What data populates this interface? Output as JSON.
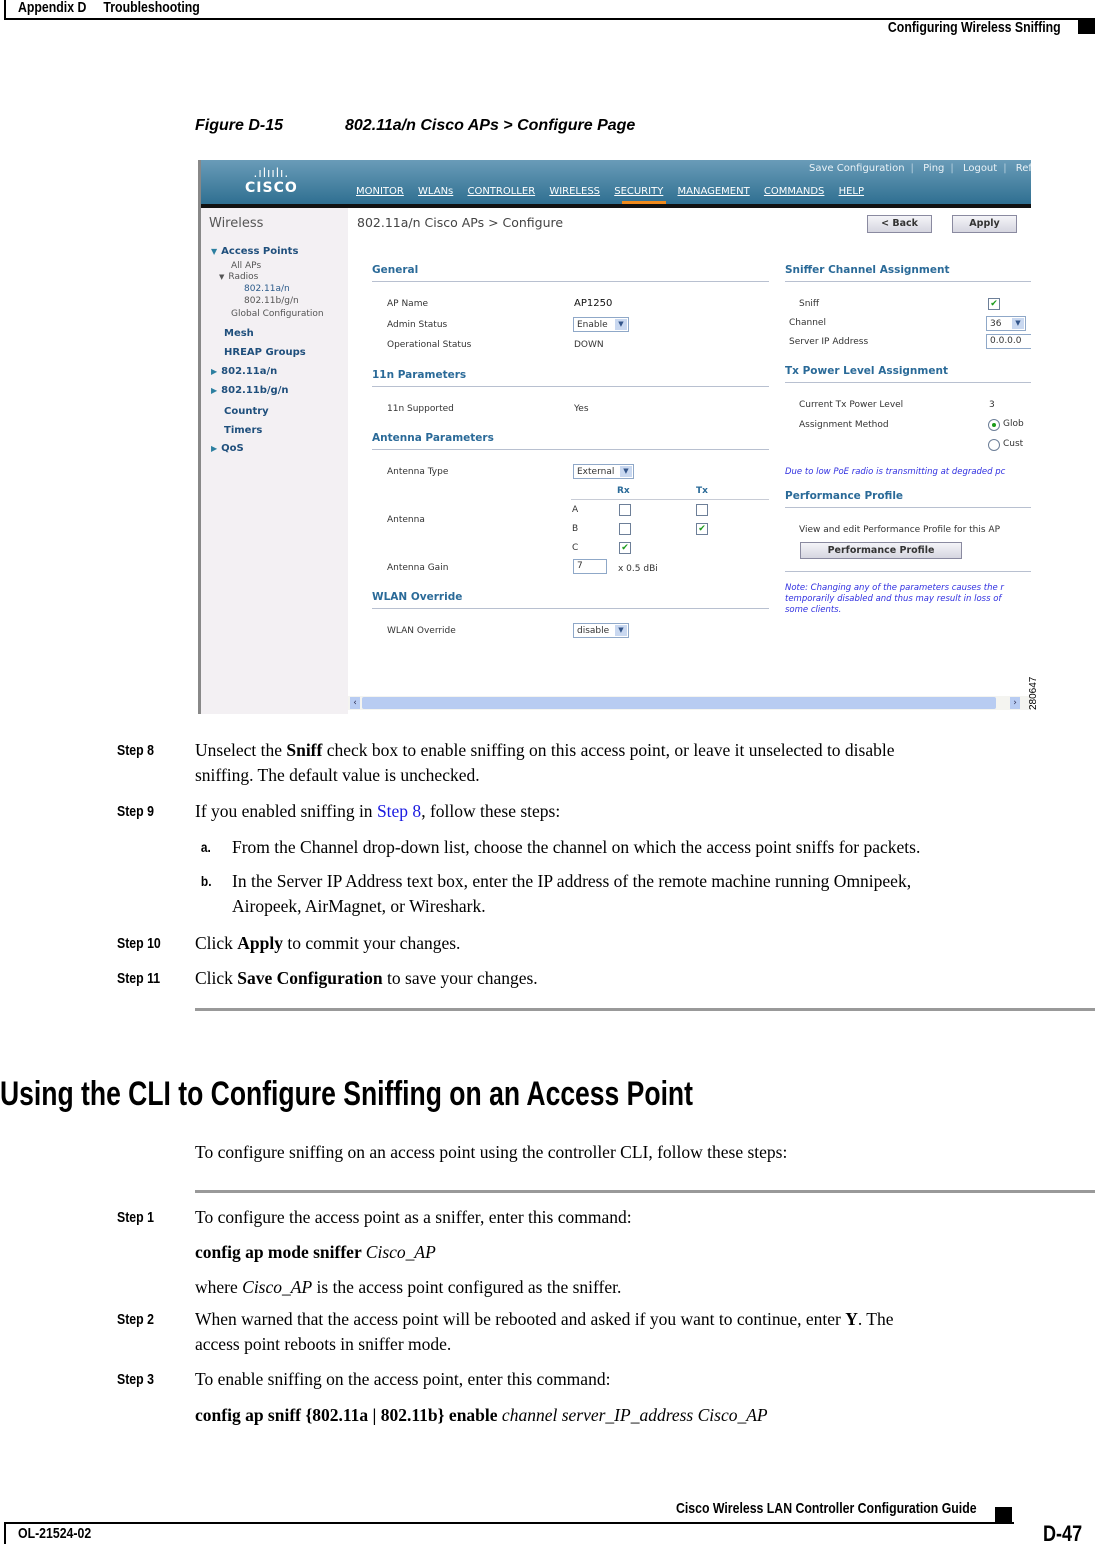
{
  "page_header": {
    "appendix": "Appendix D",
    "chapter": "Troubleshooting",
    "section": "Configuring Wireless Sniffing"
  },
  "figure": {
    "number": "Figure D-15",
    "title": "802.11a/n Cisco APs > Configure Page",
    "id": "280647"
  },
  "screenshot": {
    "logo": {
      "bars": ".ılıılı.",
      "word": "CISCO"
    },
    "top_links": [
      "Save Configuration",
      "Ping",
      "Logout",
      "Refres"
    ],
    "main_nav": [
      "MONITOR",
      "WLANs",
      "CONTROLLER",
      "WIRELESS",
      "SECURITY",
      "MANAGEMENT",
      "COMMANDS",
      "HELP"
    ],
    "main_nav_active": "WIRELESS",
    "accent_color": "#f08a1c",
    "sidebar": {
      "title": "Wireless",
      "items": [
        {
          "label": "Access Points",
          "expanded": true
        },
        {
          "label": "All APs"
        },
        {
          "label": "Radios",
          "expanded": true
        },
        {
          "label": "802.11a/n"
        },
        {
          "label": "802.11b/g/n"
        },
        {
          "label": "Global Configuration"
        },
        {
          "label": "Mesh"
        },
        {
          "label": "HREAP Groups"
        },
        {
          "label": "802.11a/n",
          "collapsed": true
        },
        {
          "label": "802.11b/g/n",
          "collapsed": true
        },
        {
          "label": "Country"
        },
        {
          "label": "Timers"
        },
        {
          "label": "QoS",
          "collapsed": true
        }
      ]
    },
    "content_title": "802.11a/n Cisco APs > Configure",
    "buttons": {
      "back": "< Back",
      "apply": "Apply",
      "performance_profile": "Performance Profile"
    },
    "general": {
      "heading": "General",
      "ap_name_label": "AP Name",
      "ap_name": "AP1250",
      "admin_status_label": "Admin Status",
      "admin_status": "Enable",
      "op_status_label": "Operational Status",
      "op_status": "DOWN"
    },
    "n11": {
      "heading": "11n Parameters",
      "supported_label": "11n Supported",
      "supported": "Yes"
    },
    "antenna": {
      "heading": "Antenna Parameters",
      "type_label": "Antenna Type",
      "type": "External",
      "antenna_label": "Antenna",
      "rx_label": "Rx",
      "tx_label": "Tx",
      "rows": [
        {
          "name": "A",
          "rx": false,
          "tx": false
        },
        {
          "name": "B",
          "rx": false,
          "tx": true
        },
        {
          "name": "C",
          "rx": true
        }
      ],
      "gain_label": "Antenna Gain",
      "gain": "7",
      "gain_unit": "x 0.5 dBi"
    },
    "wlan_override": {
      "heading": "WLAN Override",
      "label": "WLAN Override",
      "value": "disable"
    },
    "sniffer": {
      "heading": "Sniffer Channel Assignment",
      "sniff_label": "Sniff",
      "sniff": true,
      "channel_label": "Channel",
      "channel": "36",
      "server_ip_label": "Server IP Address",
      "server_ip": "0.0.0.0"
    },
    "tx_power": {
      "heading": "Tx Power Level Assignment",
      "current_label": "Current Tx Power Level",
      "current": "3",
      "method_label": "Assignment Method",
      "method_options": [
        "Glob",
        "Cust"
      ],
      "method_selected": "Glob",
      "poe_note": "Due to low PoE radio is transmitting at degraded pc"
    },
    "performance": {
      "heading": "Performance Profile",
      "desc": "View and edit Performance Profile for this AP"
    },
    "note_lines": [
      "Note: Changing any of the parameters causes the r",
      "temporarily disabled and thus may result in loss of",
      "some clients."
    ]
  },
  "steps_gui": [
    {
      "label": "Step 8",
      "pre": "Unselect the ",
      "bold": "Sniff",
      "post": " check box to enable sniffing on this access point, or leave it unselected to disable",
      "line2": "sniffing. The default value is unchecked."
    },
    {
      "label": "Step 9",
      "pre": "If you enabled sniffing in ",
      "link": "Step 8",
      "post": ", follow these steps:"
    },
    {
      "label": "Step 10",
      "pre": "Click ",
      "bold": "Apply",
      "post": " to commit your changes."
    },
    {
      "label": "Step 11",
      "pre": "Click ",
      "bold": "Save Configuration",
      "post": " to save your changes."
    }
  ],
  "substeps": [
    {
      "label": "a.",
      "text": "From the Channel drop-down list, choose the channel on which the access point sniffs for packets."
    },
    {
      "label": "b.",
      "text": "In the Server IP Address text box, enter the IP address of the remote machine running Omnipeek,",
      "line2": "Airopeek, AirMagnet, or Wireshark."
    }
  ],
  "cli_section": {
    "heading": "Using the CLI to Configure Sniffing on an Access Point",
    "intro": "To configure sniffing on an access point using the controller CLI, follow these steps:",
    "steps": [
      {
        "label": "Step 1",
        "text": "To configure the access point as a sniffer, enter this command:",
        "cmd_bold": "config ap mode sniffer ",
        "cmd_italic": "Cisco_AP",
        "where_pre": "where ",
        "where_italic": "Cisco_AP",
        "where_post": " is the access point configured as the sniffer."
      },
      {
        "label": "Step 2",
        "pre": "When warned that the access point will be rebooted and asked if you want to continue, enter ",
        "bold": "Y",
        "post": ". The",
        "line2": "access point reboots in sniffer mode."
      },
      {
        "label": "Step 3",
        "text": "To enable sniffing on the access point, enter this command:",
        "cmd_bold": "config ap sniff {802.11a | 802.11b} enable ",
        "cmd_italic": "channel server_IP_address Cisco_AP"
      }
    ]
  },
  "page_footer": {
    "guide": "Cisco Wireless LAN Controller Configuration Guide",
    "doc_number": "OL-21524-02",
    "page": "D-47"
  }
}
